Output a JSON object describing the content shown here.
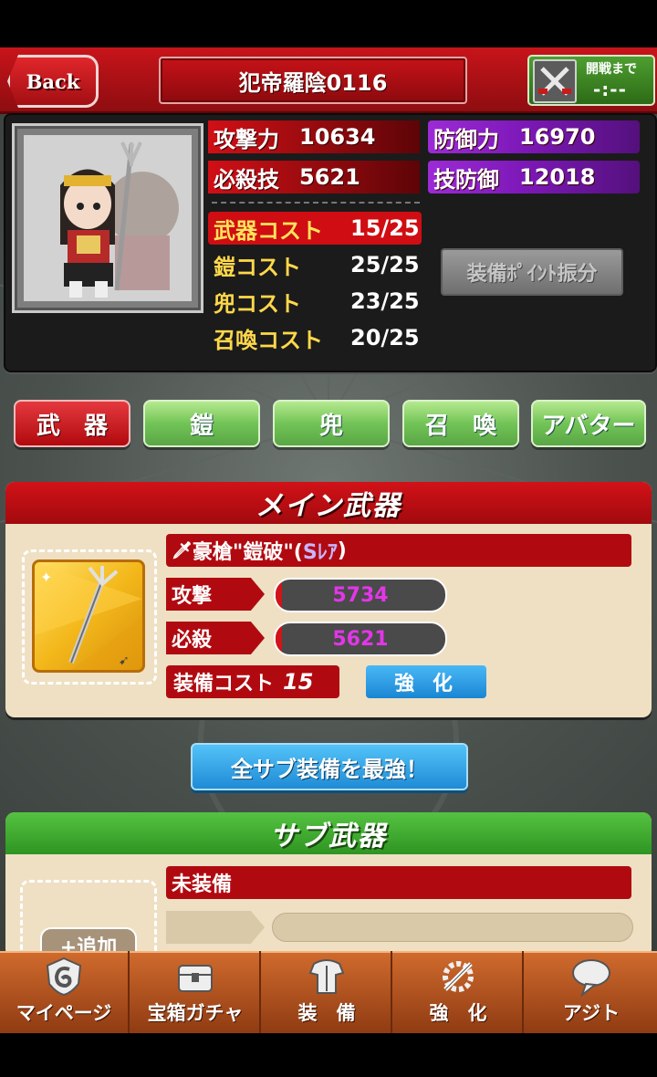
{
  "header": {
    "back_label": "Back",
    "player_name": "犯帝羅陰0116",
    "battle_label": "開戦まで",
    "battle_time": "-:--"
  },
  "stats": {
    "attack_label": "攻撃力",
    "attack_value": "10634",
    "defense_label": "防御力",
    "defense_value": "16970",
    "special_label": "必殺技",
    "special_value": "5621",
    "skill_def_label": "技防御",
    "skill_def_value": "12018"
  },
  "costs": [
    {
      "label": "武器コスト",
      "value": "15/25"
    },
    {
      "label": "鎧コスト",
      "value": "25/25"
    },
    {
      "label": "兜コスト",
      "value": "23/25"
    },
    {
      "label": "召喚コスト",
      "value": "20/25"
    }
  ],
  "alloc_button": "装備ﾎﾟｲﾝﾄ振分",
  "tabs": [
    "武　器",
    "鎧",
    "兜",
    "召　喚",
    "アバター"
  ],
  "main_weapon": {
    "title": "メイン武器",
    "name_prefix": "豪槍\"鎧破\"(",
    "rarity": "Sﾚｱ",
    "name_suffix": ")",
    "attack_label": "攻撃",
    "attack_value": "5734",
    "attack_fill": 0.04,
    "special_label": "必殺",
    "special_value": "5621",
    "special_fill": 0.04,
    "cost_label": "装備コスト",
    "cost_value": "15",
    "enhance_label": "強 化"
  },
  "all_sub_button": "全サブ装備を最強！",
  "sub_weapon": {
    "title": "サブ武器",
    "status": "未装備",
    "add_label": "+追加"
  },
  "nav": [
    {
      "label": "マイページ",
      "icon": "mypage-icon"
    },
    {
      "label": "宝箱ガチャ",
      "icon": "treasure-chest-icon"
    },
    {
      "label": "装　備",
      "icon": "armor-icon"
    },
    {
      "label": "強　化",
      "icon": "sword-gear-icon"
    },
    {
      "label": "アジト",
      "icon": "speech-bubble-icon"
    }
  ],
  "colors": {
    "header_red": "#c7141a",
    "stat_purple": "#9c2bd6",
    "tab_green": "#72c457",
    "button_blue": "#1f8bd6",
    "nav_orange": "#cf6a2d",
    "bar_value_magenta": "#e236e8"
  }
}
